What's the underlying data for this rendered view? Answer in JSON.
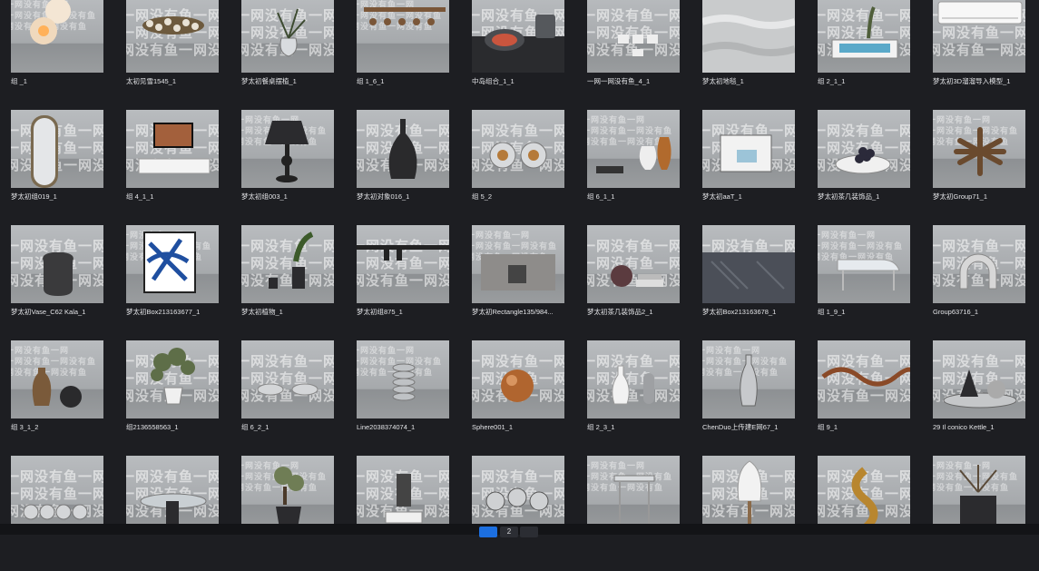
{
  "watermark": "一网没有鱼",
  "rows": [
    [
      {
        "label": "组 _1",
        "icon": "pendant-lamp"
      },
      {
        "label": "太初见雪1545_1",
        "icon": "crystal-chandelier"
      },
      {
        "label": "梦太初餐桌摆植_1",
        "icon": "vase-flowers"
      },
      {
        "label": "组 1_6_1",
        "icon": "beads-chandelier"
      },
      {
        "label": "中岛组合_1_1",
        "icon": "cooktop-pan"
      },
      {
        "label": "一网一网没有鱼_4_1",
        "icon": "wall-switches"
      },
      {
        "label": "梦太初地毯_1",
        "icon": "rug"
      },
      {
        "label": "组 2_1_1",
        "icon": "tray-plant"
      },
      {
        "label": "梦太初3D溜溜导入模型_1",
        "icon": "air-conditioner"
      }
    ],
    [
      {
        "label": "梦太初组019_1",
        "icon": "floor-mirror"
      },
      {
        "label": "组 4_1_1",
        "icon": "tv-cabinet"
      },
      {
        "label": "梦太初组003_1",
        "icon": "table-lamp"
      },
      {
        "label": "梦太初对象016_1",
        "icon": "black-vase"
      },
      {
        "label": "组 5_2",
        "icon": "glass-spheres"
      },
      {
        "label": "组 6_1_1",
        "icon": "books-vases"
      },
      {
        "label": "梦太初aaT_1",
        "icon": "art-frame"
      },
      {
        "label": "梦太初茶几装饰品_1",
        "icon": "bowl-grapes"
      },
      {
        "label": "梦太初Group71_1",
        "icon": "sculpture-burst"
      }
    ],
    [
      {
        "label": "梦太初Vase_C62 Kala_1",
        "icon": "dark-vase"
      },
      {
        "label": "梦太初Box213163677_1",
        "icon": "blue-painting"
      },
      {
        "label": "梦太初植物_1",
        "icon": "potted-plants"
      },
      {
        "label": "梦太初组875_1",
        "icon": "track-lights"
      },
      {
        "label": "梦太初Rectangle135/984...",
        "icon": "stone-block"
      },
      {
        "label": "梦太初茶几装饰品2_1",
        "icon": "books-sphere"
      },
      {
        "label": "梦太初Box213163678_1",
        "icon": "striped-slab"
      },
      {
        "label": "组 1_9_1",
        "icon": "glass-piano"
      },
      {
        "label": "Group63716_1",
        "icon": "arch-sculpture"
      }
    ],
    [
      {
        "label": "组 3_1_2",
        "icon": "bottle-vases"
      },
      {
        "label": "组2136558563_1",
        "icon": "olive-plant"
      },
      {
        "label": "组 6_2_1",
        "icon": "glass-bowls"
      },
      {
        "label": "Line2038374074_1",
        "icon": "ribbed-vase"
      },
      {
        "label": "Sphere001_1",
        "icon": "copper-sphere"
      },
      {
        "label": "组 2_3_1",
        "icon": "white-vases"
      },
      {
        "label": "ChenDuo上传建E网67_1",
        "icon": "chrome-vase"
      },
      {
        "label": "组 9_1",
        "icon": "copper-wave"
      },
      {
        "label": "29 Il conico Kettle_1",
        "icon": "kettle-cones"
      }
    ],
    [
      {
        "label": "",
        "icon": "glass-beads"
      },
      {
        "label": "",
        "icon": "glass-table"
      },
      {
        "label": "",
        "icon": "bonsai-pot"
      },
      {
        "label": "",
        "icon": "hand-sculpture"
      },
      {
        "label": "",
        "icon": "metal-discs"
      },
      {
        "label": "",
        "icon": "glass-side-table"
      },
      {
        "label": "",
        "icon": "white-lamp"
      },
      {
        "label": "",
        "icon": "gold-knot"
      },
      {
        "label": "",
        "icon": "dried-grass-pot"
      }
    ]
  ],
  "pagination": {
    "pages": [
      "",
      "2",
      ""
    ],
    "active_index": 0
  },
  "colors": {
    "background": "#1d1e22",
    "label_text": "#e4e5e8",
    "active_page": "#1c6fe0"
  }
}
